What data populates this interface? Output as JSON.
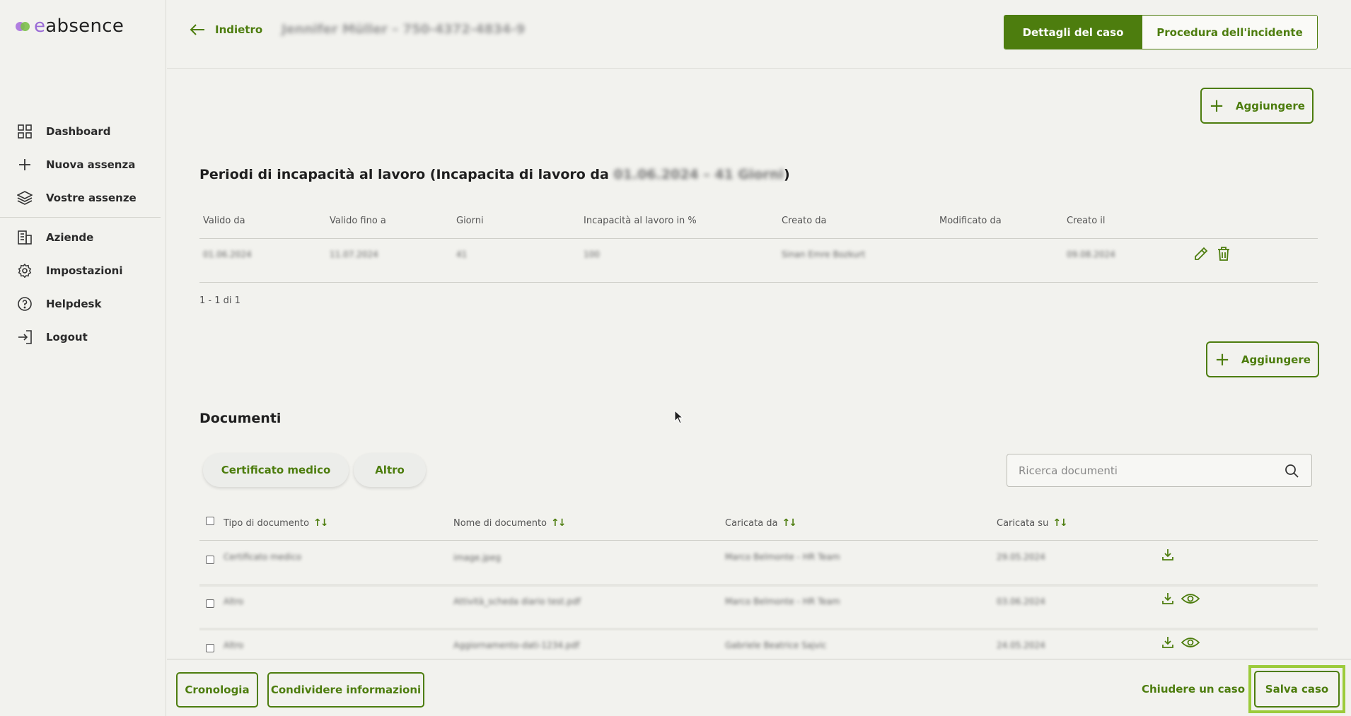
{
  "app": {
    "logo_e": "e",
    "logo_rest": "absence"
  },
  "sidebar": {
    "items": [
      {
        "label": "Dashboard",
        "icon": "grid-icon"
      },
      {
        "label": "Nuova assenza",
        "icon": "plus-icon"
      },
      {
        "label": "Vostre assenze",
        "icon": "layers-icon"
      },
      {
        "label": "Aziende",
        "icon": "building-icon"
      },
      {
        "label": "Impostazioni",
        "icon": "gear-icon"
      },
      {
        "label": "Helpdesk",
        "icon": "help-circle-icon"
      },
      {
        "label": "Logout",
        "icon": "logout-icon"
      }
    ]
  },
  "header": {
    "back_label": "Indietro",
    "case_title": "Jennifer Müller – 750-4372-4834-9",
    "tabs": [
      {
        "label": "Dettagli del caso",
        "active": true
      },
      {
        "label": "Procedura dell'incidente",
        "active": false
      }
    ]
  },
  "periods": {
    "add_label": "Aggiungere",
    "title_prefix": "Periodi di incapacità al lavoro (Incapacita di lavoro da ",
    "title_blurred": "01.06.2024 – 41 Giorni",
    "title_suffix": ")",
    "columns": [
      "Valido da",
      "Valido fino a",
      "Giorni",
      "Incapacità al lavoro in %",
      "Creato da",
      "Modificato da",
      "Creato il"
    ],
    "rows": [
      {
        "valid_from": "01.06.2024",
        "valid_to": "11.07.2024",
        "days": "41",
        "percent": "100",
        "created_by": "Sinan Emre Bozkurt",
        "modified_by": "",
        "created_on": "09.08.2024"
      }
    ],
    "pagination": "1 - 1 di 1"
  },
  "documents": {
    "add_label": "Aggiungere",
    "title": "Documenti",
    "filters": [
      "Certificato medico",
      "Altro"
    ],
    "search_placeholder": "Ricerca documenti",
    "columns": [
      "Tipo di documento",
      "Nome di documento",
      "Caricata da",
      "Caricata su"
    ],
    "rows": [
      {
        "type": "Certificato medico",
        "name": "image.jpeg",
        "uploaded_by": "Marco Belmonte - HR Team",
        "uploaded_on": "29.05.2024"
      },
      {
        "type": "Altro",
        "name": "Attività_scheda diario test.pdf",
        "uploaded_by": "Marco Belmonte - HR Team",
        "uploaded_on": "03.06.2024"
      },
      {
        "type": "Altro",
        "name": "Aggiornamento-dati-1234.pdf",
        "uploaded_by": "Gabriele Beatrice Sajvic",
        "uploaded_on": "24.05.2024"
      }
    ]
  },
  "footer": {
    "history_label": "Cronologia",
    "share_label": "Condividere informazioni",
    "close_label": "Chiudere un caso",
    "save_label": "Salva caso"
  },
  "colors": {
    "accent": "#4d7d0e",
    "highlight": "#9ccb3b",
    "background": "#f2f2ee"
  }
}
